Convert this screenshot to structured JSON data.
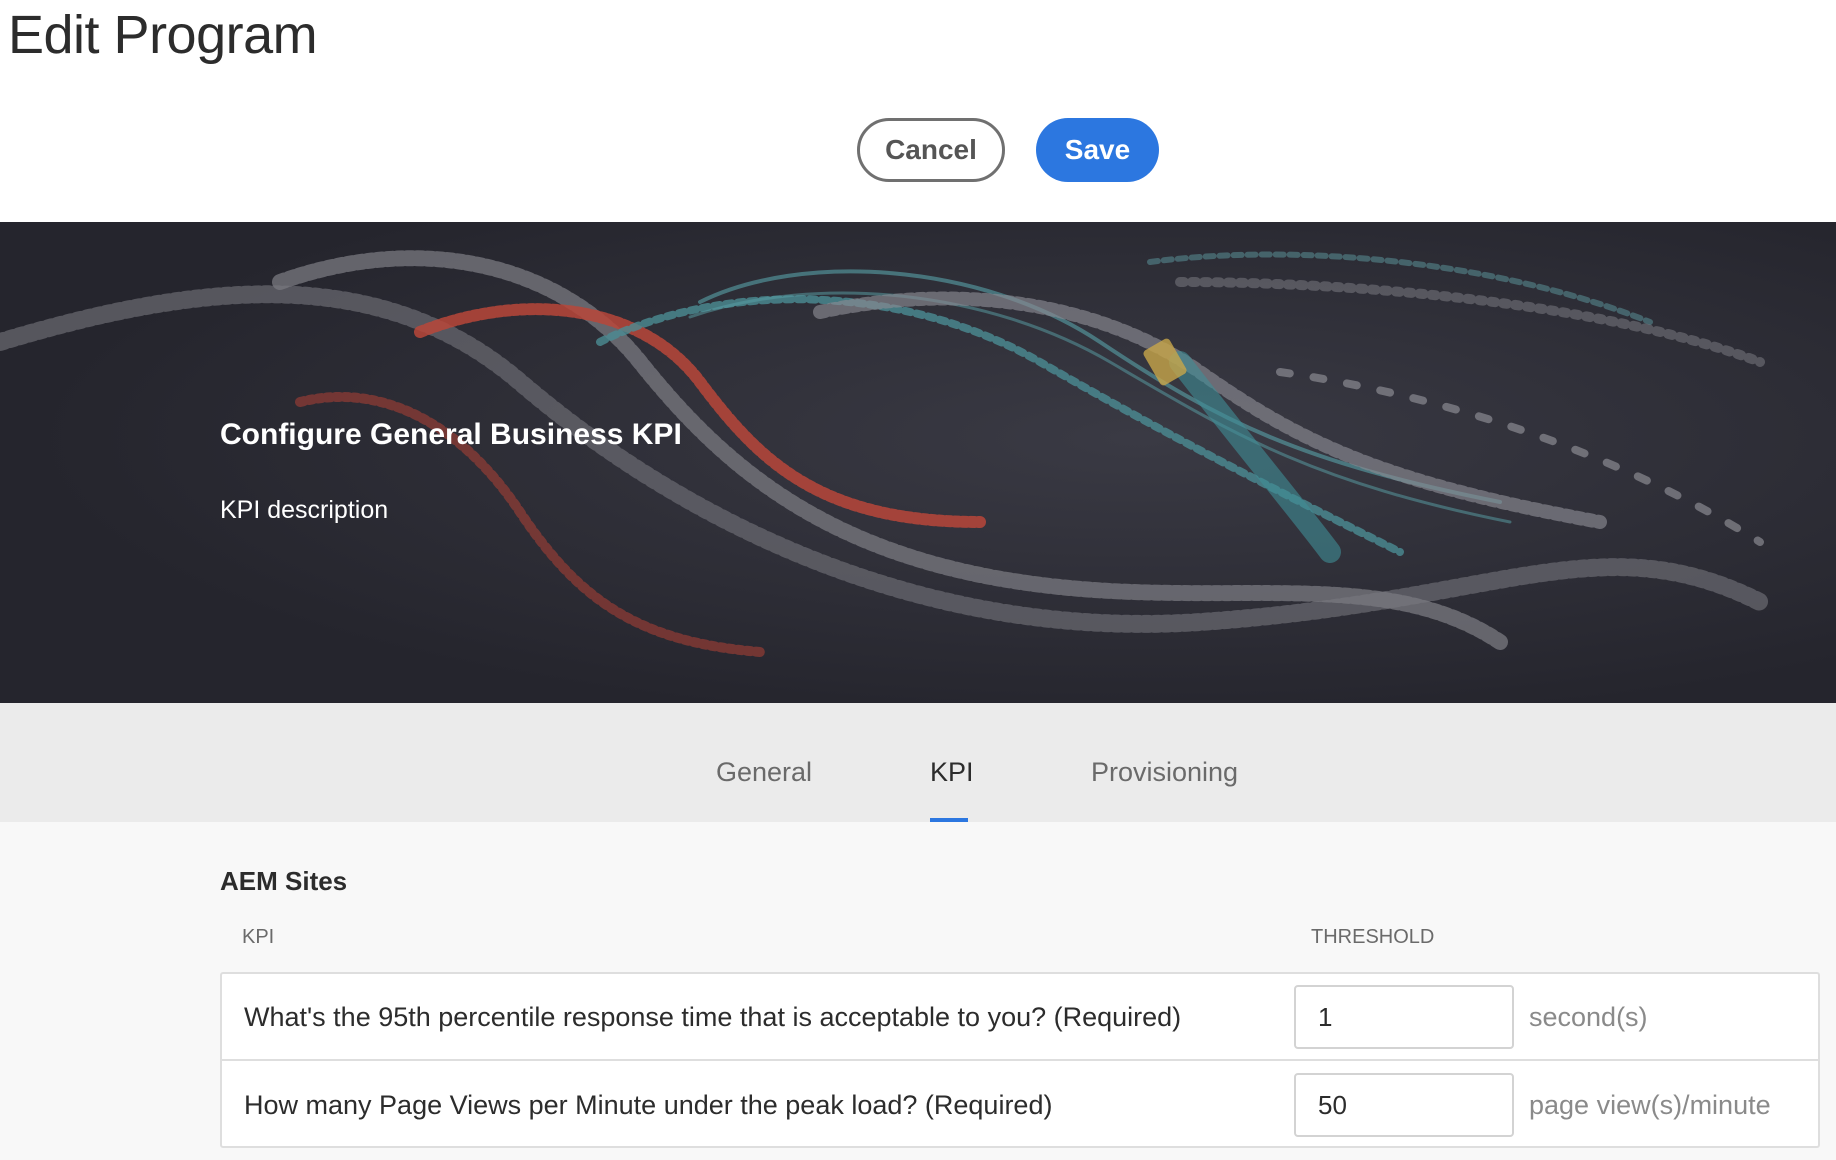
{
  "header": {
    "title": "Edit Program",
    "cancel_label": "Cancel",
    "save_label": "Save"
  },
  "hero": {
    "title": "Configure General Business KPI",
    "description": "KPI description"
  },
  "tabs": [
    {
      "label": "General",
      "active": false
    },
    {
      "label": "KPI",
      "active": true
    },
    {
      "label": "Provisioning",
      "active": false
    }
  ],
  "section": {
    "title": "AEM Sites",
    "col_kpi": "KPI",
    "col_threshold": "THRESHOLD",
    "rows": [
      {
        "question": "What's the 95th percentile response time that is acceptable to you? (Required)",
        "value": "1",
        "unit": "second(s)"
      },
      {
        "question": "How many Page Views per Minute under the peak load? (Required)",
        "value": "50",
        "unit": "page view(s)/minute"
      }
    ]
  },
  "colors": {
    "accent": "#2c77e0",
    "hero_background": "#25252d",
    "tabbar_background": "#ebebeb"
  }
}
